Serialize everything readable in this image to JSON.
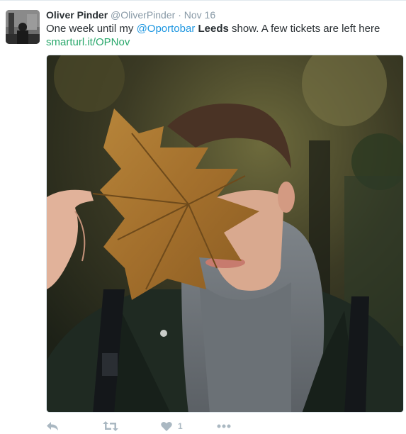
{
  "tweet": {
    "fullname": "Oliver Pinder",
    "username": "@OliverPinder",
    "separator": "·",
    "time": "Nov 16",
    "text_before": "One week until my ",
    "mention": "@Oportobar",
    "bold_word": "Leeds",
    "text_after": " show. A few tickets are left here",
    "link": "smarturl.it/OPNov"
  },
  "actions": {
    "reply_icon": "reply-icon",
    "retweet_icon": "retweet-icon",
    "like_icon": "heart-icon",
    "like_count": "1",
    "more_icon": "more-icon"
  },
  "colors": {
    "link": "#2aa86c",
    "mention": "#1b95e0",
    "action": "#aab8c2"
  }
}
